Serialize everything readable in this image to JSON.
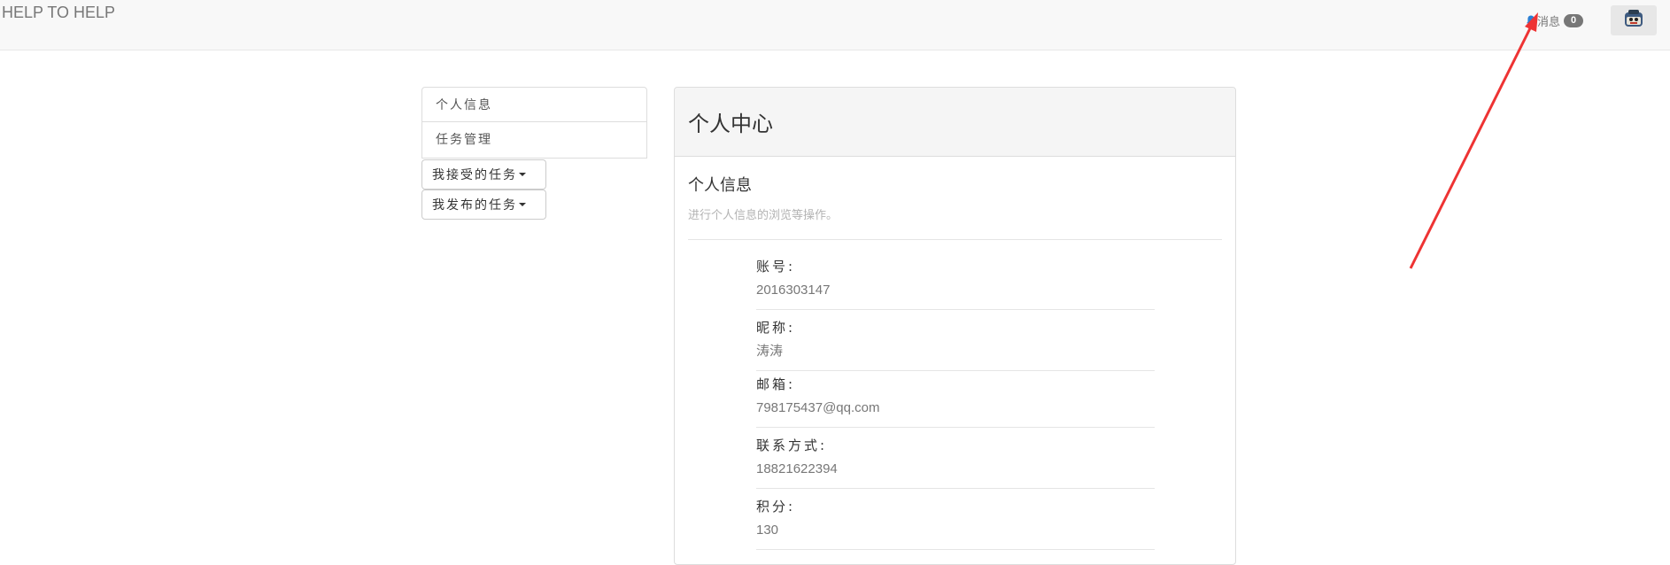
{
  "navbar": {
    "brand": "HELP TO HELP",
    "messages_label": "消息",
    "messages_count": "0"
  },
  "sidebar": {
    "items": [
      {
        "label": "个人信息"
      },
      {
        "label": "任务管理"
      }
    ],
    "dropdowns": [
      {
        "label": "我接受的任务"
      },
      {
        "label": "我发布的任务"
      }
    ]
  },
  "panel": {
    "heading": "个人中心",
    "section_title": "个人信息",
    "section_subtitle": "进行个人信息的浏览等操作。",
    "fields": [
      {
        "label": "账号:",
        "value": "2016303147"
      },
      {
        "label": "昵称:",
        "value": "涛涛"
      },
      {
        "label": "邮箱:",
        "value": "798175437@qq.com"
      },
      {
        "label": "联系方式:",
        "value": "18821622394"
      },
      {
        "label": "积分:",
        "value": "130"
      }
    ]
  },
  "icons": {
    "bell": "bell-icon",
    "avatar": "avatar-icon",
    "caret": "caret-down-icon"
  },
  "colors": {
    "navbar_bg": "#f8f8f8",
    "badge_bg": "#777777",
    "bell": "#2a7fd4",
    "annotation_arrow": "#ee3333"
  }
}
